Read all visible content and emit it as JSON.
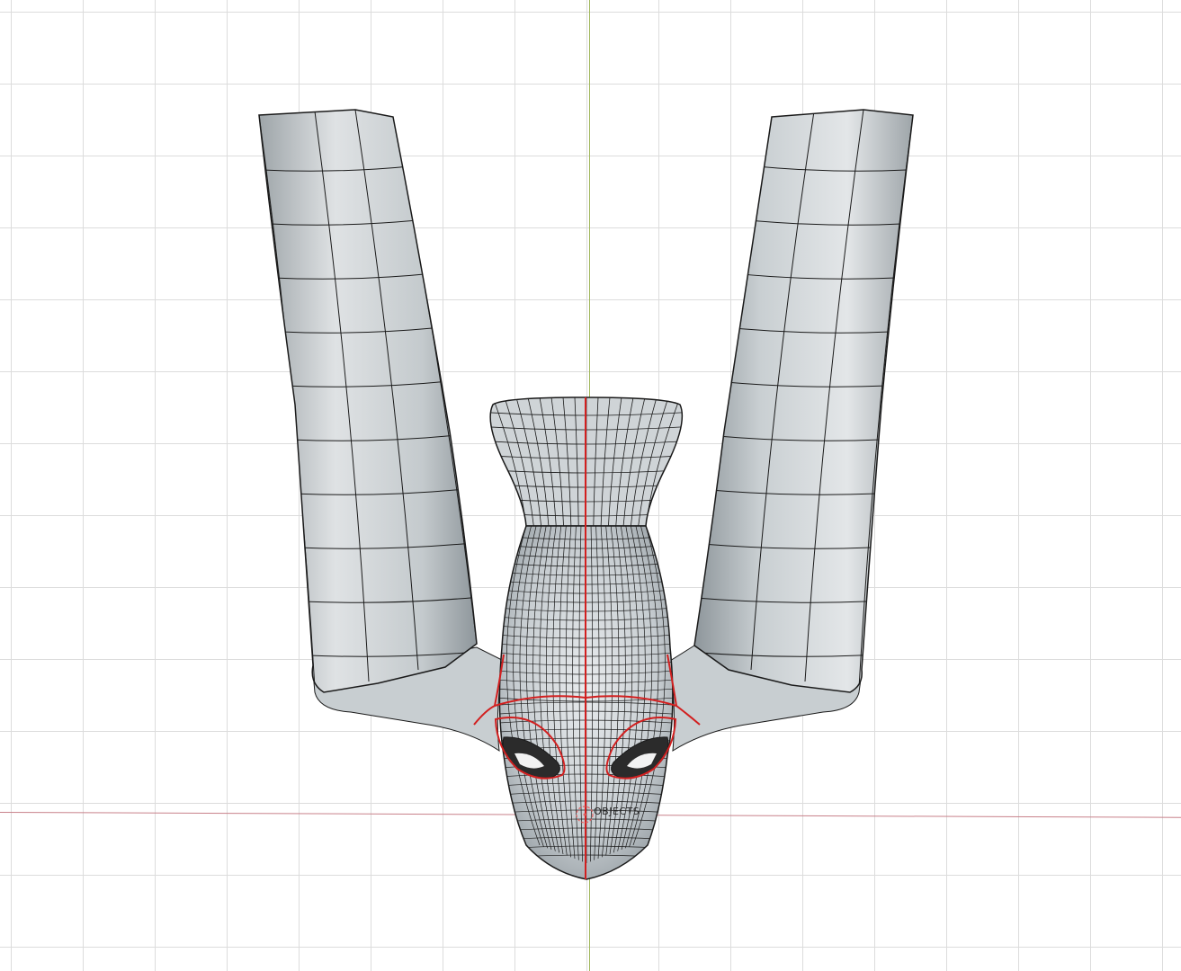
{
  "viewport": {
    "object_label": "OBJECTS"
  },
  "colors": {
    "background": "#ffffff",
    "grid_line": "#dcdcdc",
    "x_axis": "#c8818a",
    "y_axis": "#9fb65a",
    "mesh_fill": "#c9ced1",
    "wire": "#1a1a1a",
    "seam": "#d21f1f"
  },
  "icons": {
    "origin": "origin-dashed-circle-icon"
  }
}
